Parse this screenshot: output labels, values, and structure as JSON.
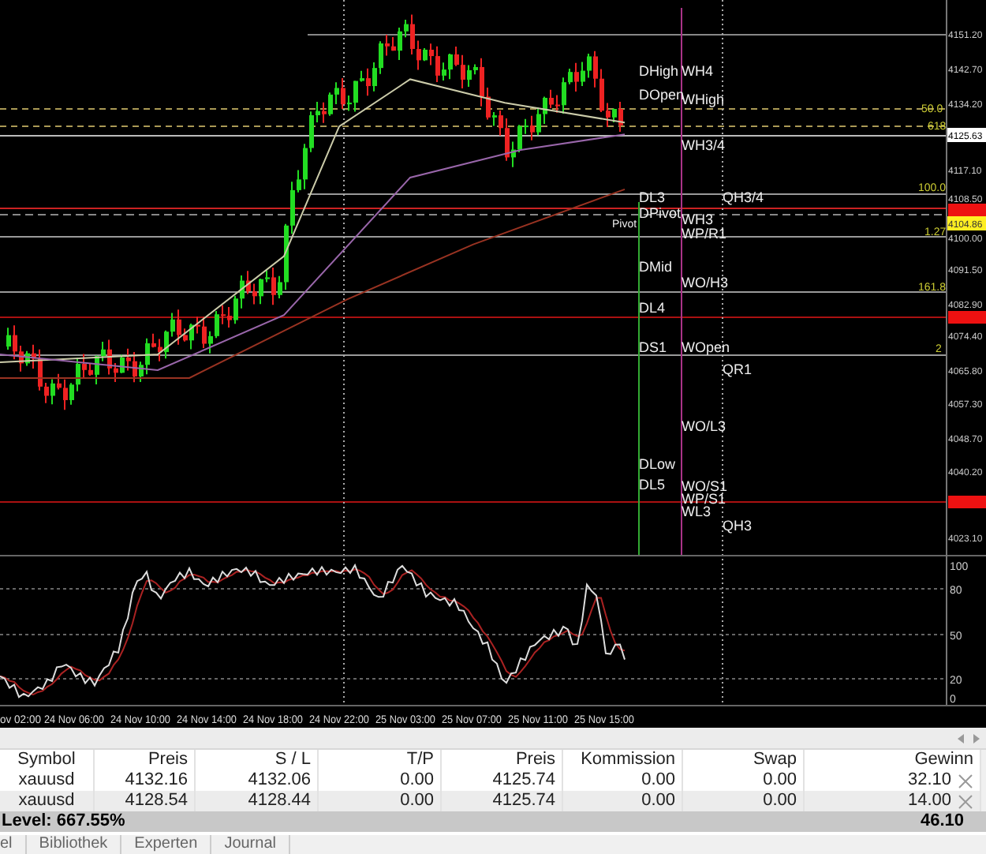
{
  "chart": {
    "price_axis": [
      {
        "label": "4151.20",
        "kind": "tick"
      },
      {
        "label": "4142.70",
        "kind": "tick"
      },
      {
        "label": "4134.20",
        "kind": "tick"
      },
      {
        "label": "4125.63",
        "kind": "current"
      },
      {
        "label": "4117.10",
        "kind": "tick"
      },
      {
        "label": "4108.50",
        "kind": "tick"
      },
      {
        "kind": "alert"
      },
      {
        "label": "4104.86",
        "kind": "pivot"
      },
      {
        "label": "4100.00",
        "kind": "tick"
      },
      {
        "label": "4091.50",
        "kind": "tick"
      },
      {
        "label": "4082.90",
        "kind": "tick"
      },
      {
        "kind": "alert"
      },
      {
        "label": "4074.40",
        "kind": "tick"
      },
      {
        "label": "4065.80",
        "kind": "tick"
      },
      {
        "label": "4057.30",
        "kind": "tick"
      },
      {
        "label": "4048.70",
        "kind": "tick"
      },
      {
        "label": "4040.20",
        "kind": "tick"
      },
      {
        "kind": "alert"
      },
      {
        "label": "4023.10",
        "kind": "tick"
      }
    ],
    "fib_labels": [
      "50.0",
      "618",
      "100.0",
      "1.27",
      "161.8",
      "2"
    ],
    "level_labels": [
      "DHigh",
      "WH4",
      "DOpen",
      "WHigh",
      "WH3/4",
      "DL3",
      "QH3/4",
      "DPivot",
      "Pivot",
      "WH3",
      "WP/R1",
      "DMid",
      "WO/H3",
      "DL4",
      "DS1",
      "WOpen",
      "QR1",
      "WO/L3",
      "DLow",
      "DL5",
      "WO/S1",
      "WP/S1",
      "WL3",
      "QH3"
    ],
    "oscillator_axis": [
      "100",
      "80",
      "50",
      "20",
      "0"
    ],
    "time_axis": [
      "ov 02:00",
      "24 Nov 06:00",
      "24 Nov 10:00",
      "24 Nov 14:00",
      "24 Nov 18:00",
      "24 Nov 22:00",
      "25 Nov 03:00",
      "25 Nov 07:00",
      "25 Nov 11:00",
      "25 Nov 15:00"
    ]
  },
  "positions": {
    "columns": [
      "Symbol",
      "Preis",
      "S / L",
      "T/P",
      "Preis",
      "Kommission",
      "Swap",
      "Gewinn"
    ],
    "rows": [
      {
        "cells": [
          "xauusd",
          "4132.16",
          "4132.06",
          "0.00",
          "4125.74",
          "0.00",
          "0.00",
          "32.10"
        ]
      },
      {
        "cells": [
          "xauusd",
          "4128.54",
          "4128.44",
          "0.00",
          "4125.74",
          "0.00",
          "0.00",
          "14.00"
        ]
      }
    ],
    "summary": {
      "label": "Level: 667.55%",
      "total": "46.10"
    }
  },
  "tabs": [
    "el",
    "Bibliothek",
    "Experten",
    "Journal"
  ]
}
